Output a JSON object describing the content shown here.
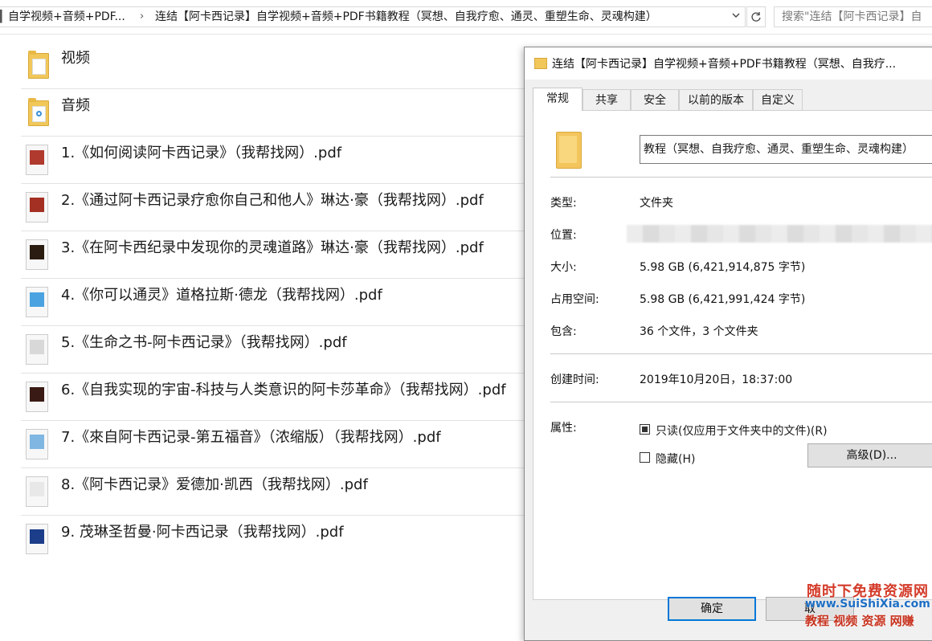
{
  "address_bar": {
    "lead": "▎",
    "crumb1": "自学视频+音频+PDF...",
    "separator": "›",
    "crumb2": "连结【阿卡西记录】自学视频+音频+PDF书籍教程（冥想、自我疗愈、通灵、重塑生命、灵魂构建）",
    "dropdown_icon": "chevron-down-icon",
    "refresh_icon": "refresh-icon",
    "search_placeholder": "搜索\"连结【阿卡西记录】自"
  },
  "file_list": [
    {
      "name": "视频",
      "icon": "folder-icon"
    },
    {
      "name": "音频",
      "icon": "folder-audio-icon"
    },
    {
      "name": "1.《如何阅读阿卡西记录》（我帮找网）.pdf",
      "icon": "pdf-thumbnail-icon",
      "color": "#b03a2e"
    },
    {
      "name": "2.《通过阿卡西记录疗愈你自己和他人》琳达·豪（我帮找网）.pdf",
      "icon": "pdf-thumbnail-icon",
      "color": "#a33022"
    },
    {
      "name": "3.《在阿卡西纪录中发现你的灵魂道路》琳达·豪（我帮找网）.pdf",
      "icon": "pdf-thumbnail-icon",
      "color": "#2a1c10"
    },
    {
      "name": "4.《你可以通灵》道格拉斯·德龙（我帮找网）.pdf",
      "icon": "pdf-thumbnail-icon",
      "color": "#4aa3e0"
    },
    {
      "name": "5.《生命之书-阿卡西记录》（我帮找网）.pdf",
      "icon": "pdf-thumbnail-icon",
      "color": "#d8d8d8"
    },
    {
      "name": "6.《自我实现的宇宙-科技与人类意识的阿卡莎革命》（我帮找网）.pdf",
      "icon": "pdf-thumbnail-icon",
      "color": "#3a1a14"
    },
    {
      "name": "7.《來自阿卡西记录-第五福音》（浓缩版）（我帮找网）.pdf",
      "icon": "pdf-thumbnail-icon",
      "color": "#7fb6e2"
    },
    {
      "name": "8.《阿卡西记录》爱德加·凯西（我帮找网）.pdf",
      "icon": "pdf-thumbnail-icon",
      "color": "#e8e8e8"
    },
    {
      "name": "9. 茂琳圣哲曼·阿卡西记录（我帮找网）.pdf",
      "icon": "pdf-thumbnail-icon",
      "color": "#1c3d8a"
    }
  ],
  "dialog": {
    "title": "连结【阿卡西记录】自学视频+音频+PDF书籍教程（冥想、自我疗...",
    "tabs": [
      "常规",
      "共享",
      "安全",
      "以前的版本",
      "自定义"
    ],
    "active_tab": "常规",
    "folder_name": "教程（冥想、自我疗愈、通灵、重塑生命、灵魂构建）",
    "type_label": "类型:",
    "type_value": "文件夹",
    "location_label": "位置:",
    "size_label": "大小:",
    "size_value": "5.98 GB (6,421,914,875 字节)",
    "disk_label": "占用空间:",
    "disk_value": "5.98 GB (6,421,991,424 字节)",
    "contains_label": "包含:",
    "contains_value": "36 个文件，3 个文件夹",
    "created_label": "创建时间:",
    "created_value": "2019年10月20日，18:37:00",
    "attributes_label": "属性:",
    "readonly_label": "只读(仅应用于文件夹中的文件)(R)",
    "readonly_checked": true,
    "hidden_label": "隐藏(H)",
    "hidden_checked": false,
    "advanced_button": "高级(D)...",
    "ok_button": "确定",
    "cancel_button": "取"
  },
  "watermark": {
    "line1": "随时下免费资源网",
    "line2": "www.SuiShiXia.com",
    "line3": "教程 视频 资源 网赚"
  }
}
